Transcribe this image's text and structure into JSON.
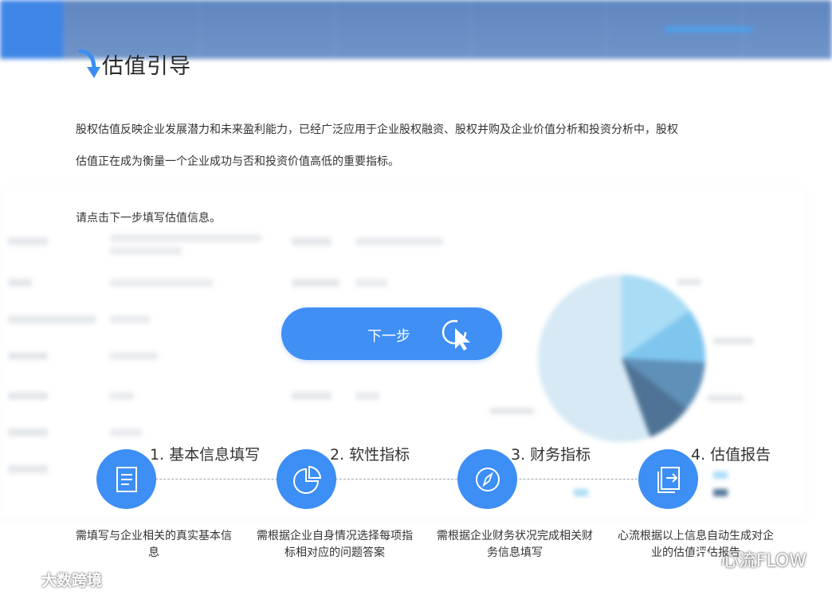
{
  "background": {
    "nav_items": [
      "",
      "",
      "",
      "",
      ""
    ],
    "nav_user": "",
    "section_head_1": "",
    "section_head_2": "",
    "pie_title": ""
  },
  "guide": {
    "title": "估值引导",
    "intro_line1": "股权估值反映企业发展潜力和未来盈利能力，已经广泛应用于企业股权融资、股权并购及企业价值分析和投资分析中，股权",
    "intro_line2": "估值正在成为衡量一个企业成功与否和投资价值高低的重要指标。",
    "instruction": "请点击下一步填写估值信息。",
    "next_button": "下一步",
    "steps": [
      {
        "title": "1. 基本信息填写",
        "desc": "需填写与企业相关的真实基本信息",
        "icon": "document-icon"
      },
      {
        "title": "2. 软性指标",
        "desc": "需根据企业自身情况选择每项指标相对应的问题答案",
        "icon": "pie-chart-icon"
      },
      {
        "title": "3. 财务指标",
        "desc": "需根据企业财务状况完成相关财务信息填写",
        "icon": "compass-icon"
      },
      {
        "title": "4. 估值报告",
        "desc": "心流根据以上信息自动生成对企业的估值评估报告",
        "icon": "report-export-icon"
      }
    ]
  },
  "watermarks": {
    "left": "大数跨境",
    "right": "心流FLOW"
  },
  "colors": {
    "accent": "#3d8ef5",
    "nav_bg": "#6a8fc6",
    "pie": [
      "#7fc6ee",
      "#5f90b8",
      "#4f7396",
      "#d6e9f5"
    ]
  }
}
